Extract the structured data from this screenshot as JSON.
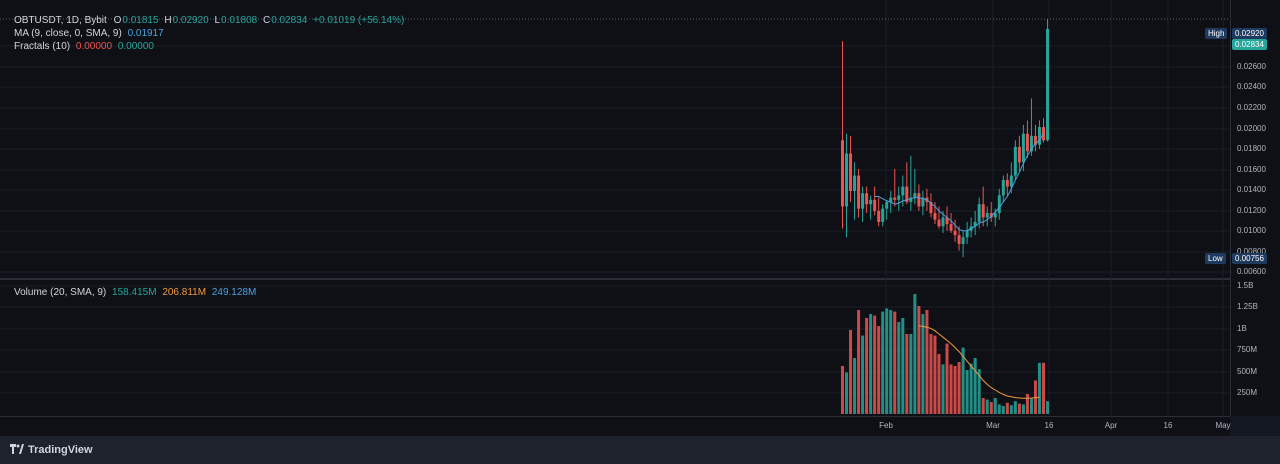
{
  "legend": {
    "symbol": "OBTUSDT, 1D, Bybit",
    "open_label": "O",
    "open": "0.01815",
    "high_label": "H",
    "high": "0.02920",
    "low_label": "L",
    "low": "0.01808",
    "close_label": "C",
    "close": "0.02834",
    "change": "+0.01019 (+56.14%)",
    "ma_label": "MA (9, close, 0, SMA, 9)",
    "ma_value": "0.01917",
    "fractals_label": "Fractals (10)",
    "fractal_up": "0.00000",
    "fractal_down": "0.00000",
    "volume_label": "Volume (20, SMA, 9)",
    "vol_value": "158.415M",
    "vol_sma20": "206.811M",
    "vol_sma9": "249.128M"
  },
  "price_axis": [
    "0.02800",
    "0.02600",
    "0.02400",
    "0.02200",
    "0.02000",
    "0.01800",
    "0.01600",
    "0.01400",
    "0.01200",
    "0.01000",
    "0.00800",
    "0.00600"
  ],
  "volume_axis": [
    "1.5B",
    "1.25B",
    "1B",
    "750M",
    "500M",
    "250M"
  ],
  "time_axis": [
    "Feb",
    "Mar",
    "16",
    "Apr",
    "16",
    "May"
  ],
  "markers": {
    "high_tag": "High",
    "high_value": "0.02920",
    "last_value": "0.02834",
    "low_tag": "Low",
    "low_value": "0.00756"
  },
  "brand": "TradingView",
  "colors": {
    "up": "#26a69a",
    "down": "#ef5350",
    "ma": "#4aa3df",
    "vol_sma20": "#f29a3d",
    "vol_sma9": "#4aa3df"
  },
  "chart_data": {
    "type": "candlestick",
    "price_range": [
      0.0058,
      0.0302
    ],
    "volume_range": [
      0,
      1600000000
    ],
    "candles": [
      {
        "o": 0.0182,
        "h": 0.0272,
        "l": 0.0102,
        "c": 0.0122,
        "v": 600000000
      },
      {
        "o": 0.0122,
        "h": 0.0188,
        "l": 0.0094,
        "c": 0.017,
        "v": 520000000
      },
      {
        "o": 0.017,
        "h": 0.0186,
        "l": 0.0126,
        "c": 0.0136,
        "v": 1050000000
      },
      {
        "o": 0.0136,
        "h": 0.0162,
        "l": 0.011,
        "c": 0.015,
        "v": 700000000
      },
      {
        "o": 0.015,
        "h": 0.0156,
        "l": 0.0112,
        "c": 0.012,
        "v": 1300000000
      },
      {
        "o": 0.012,
        "h": 0.014,
        "l": 0.0108,
        "c": 0.0134,
        "v": 980000000
      },
      {
        "o": 0.0134,
        "h": 0.014,
        "l": 0.0116,
        "c": 0.0124,
        "v": 1200000000
      },
      {
        "o": 0.0124,
        "h": 0.0132,
        "l": 0.011,
        "c": 0.0128,
        "v": 1250000000
      },
      {
        "o": 0.0128,
        "h": 0.014,
        "l": 0.0114,
        "c": 0.0118,
        "v": 1230000000
      },
      {
        "o": 0.0118,
        "h": 0.013,
        "l": 0.0104,
        "c": 0.0108,
        "v": 1100000000
      },
      {
        "o": 0.0108,
        "h": 0.0124,
        "l": 0.0104,
        "c": 0.012,
        "v": 1280000000
      },
      {
        "o": 0.012,
        "h": 0.0128,
        "l": 0.011,
        "c": 0.0126,
        "v": 1320000000
      },
      {
        "o": 0.0126,
        "h": 0.0136,
        "l": 0.0116,
        "c": 0.013,
        "v": 1300000000
      },
      {
        "o": 0.013,
        "h": 0.0156,
        "l": 0.0122,
        "c": 0.0128,
        "v": 1280000000
      },
      {
        "o": 0.0128,
        "h": 0.014,
        "l": 0.0118,
        "c": 0.0132,
        "v": 1150000000
      },
      {
        "o": 0.0132,
        "h": 0.015,
        "l": 0.0122,
        "c": 0.014,
        "v": 1200000000
      },
      {
        "o": 0.014,
        "h": 0.0162,
        "l": 0.0124,
        "c": 0.0126,
        "v": 1000000000
      },
      {
        "o": 0.0126,
        "h": 0.0168,
        "l": 0.0118,
        "c": 0.013,
        "v": 1000000000
      },
      {
        "o": 0.013,
        "h": 0.0156,
        "l": 0.0124,
        "c": 0.0134,
        "v": 1500000000
      },
      {
        "o": 0.0134,
        "h": 0.0142,
        "l": 0.0118,
        "c": 0.0122,
        "v": 1350000000
      },
      {
        "o": 0.0122,
        "h": 0.0136,
        "l": 0.0114,
        "c": 0.013,
        "v": 1250000000
      },
      {
        "o": 0.013,
        "h": 0.0138,
        "l": 0.0118,
        "c": 0.0126,
        "v": 1300000000
      },
      {
        "o": 0.0126,
        "h": 0.0134,
        "l": 0.0112,
        "c": 0.0116,
        "v": 1000000000
      },
      {
        "o": 0.0116,
        "h": 0.0126,
        "l": 0.0106,
        "c": 0.011,
        "v": 980000000
      },
      {
        "o": 0.011,
        "h": 0.0122,
        "l": 0.0102,
        "c": 0.0104,
        "v": 750000000
      },
      {
        "o": 0.0104,
        "h": 0.0118,
        "l": 0.0098,
        "c": 0.0112,
        "v": 620000000
      },
      {
        "o": 0.0112,
        "h": 0.0122,
        "l": 0.01,
        "c": 0.0106,
        "v": 880000000
      },
      {
        "o": 0.0106,
        "h": 0.0116,
        "l": 0.0098,
        "c": 0.01,
        "v": 620000000
      },
      {
        "o": 0.01,
        "h": 0.011,
        "l": 0.009,
        "c": 0.0096,
        "v": 600000000
      },
      {
        "o": 0.0096,
        "h": 0.0104,
        "l": 0.0082,
        "c": 0.0088,
        "v": 650000000
      },
      {
        "o": 0.0088,
        "h": 0.01,
        "l": 0.0076,
        "c": 0.0094,
        "v": 830000000
      },
      {
        "o": 0.0094,
        "h": 0.0108,
        "l": 0.0088,
        "c": 0.01,
        "v": 550000000
      },
      {
        "o": 0.01,
        "h": 0.0112,
        "l": 0.0094,
        "c": 0.0104,
        "v": 630000000
      },
      {
        "o": 0.0104,
        "h": 0.0118,
        "l": 0.0096,
        "c": 0.0108,
        "v": 700000000
      },
      {
        "o": 0.0108,
        "h": 0.013,
        "l": 0.0102,
        "c": 0.0124,
        "v": 560000000
      },
      {
        "o": 0.0124,
        "h": 0.014,
        "l": 0.0104,
        "c": 0.0112,
        "v": 200000000
      },
      {
        "o": 0.0112,
        "h": 0.0122,
        "l": 0.0104,
        "c": 0.0116,
        "v": 180000000
      },
      {
        "o": 0.0116,
        "h": 0.0126,
        "l": 0.0108,
        "c": 0.0112,
        "v": 150000000
      },
      {
        "o": 0.0112,
        "h": 0.012,
        "l": 0.0104,
        "c": 0.0116,
        "v": 200000000
      },
      {
        "o": 0.0116,
        "h": 0.0138,
        "l": 0.011,
        "c": 0.0132,
        "v": 120000000
      },
      {
        "o": 0.0132,
        "h": 0.015,
        "l": 0.0126,
        "c": 0.0146,
        "v": 100000000
      },
      {
        "o": 0.0146,
        "h": 0.0152,
        "l": 0.0132,
        "c": 0.014,
        "v": 140000000
      },
      {
        "o": 0.014,
        "h": 0.0162,
        "l": 0.0134,
        "c": 0.015,
        "v": 110000000
      },
      {
        "o": 0.015,
        "h": 0.0182,
        "l": 0.0146,
        "c": 0.0176,
        "v": 160000000
      },
      {
        "o": 0.0176,
        "h": 0.0186,
        "l": 0.0154,
        "c": 0.0162,
        "v": 130000000
      },
      {
        "o": 0.0162,
        "h": 0.0196,
        "l": 0.0154,
        "c": 0.0188,
        "v": 120000000
      },
      {
        "o": 0.0188,
        "h": 0.02,
        "l": 0.0166,
        "c": 0.0172,
        "v": 250000000
      },
      {
        "o": 0.0172,
        "h": 0.022,
        "l": 0.0168,
        "c": 0.0186,
        "v": 200000000
      },
      {
        "o": 0.0186,
        "h": 0.0196,
        "l": 0.0172,
        "c": 0.0178,
        "v": 420000000
      },
      {
        "o": 0.0178,
        "h": 0.02,
        "l": 0.0174,
        "c": 0.0194,
        "v": 640000000
      },
      {
        "o": 0.0194,
        "h": 0.0202,
        "l": 0.018,
        "c": 0.0182,
        "v": 640000000
      },
      {
        "o": 0.0182,
        "h": 0.0292,
        "l": 0.0181,
        "c": 0.0283,
        "v": 160000000
      }
    ],
    "ma": [
      null,
      null,
      null,
      null,
      null,
      null,
      null,
      null,
      0.0131,
      0.0131,
      0.0129,
      0.0127,
      0.0126,
      0.0124,
      0.0125,
      0.0127,
      0.0128,
      0.0129,
      0.013,
      0.013,
      0.0129,
      0.0128,
      0.0125,
      0.0122,
      0.0118,
      0.0115,
      0.0112,
      0.0109,
      0.0105,
      0.0101,
      0.01,
      0.01,
      0.0102,
      0.0104,
      0.0107,
      0.0108,
      0.011,
      0.0113,
      0.0117,
      0.0121,
      0.0126,
      0.0131,
      0.0138,
      0.0146,
      0.0153,
      0.0161,
      0.0168,
      0.0174,
      0.0179,
      0.0182,
      0.0188
    ],
    "vol_sma20": [
      null,
      null,
      null,
      null,
      null,
      null,
      null,
      null,
      null,
      null,
      null,
      null,
      null,
      null,
      null,
      null,
      null,
      null,
      null,
      1100000000,
      1095000000,
      1085000000,
      1070000000,
      1040000000,
      1000000000,
      960000000,
      920000000,
      880000000,
      830000000,
      780000000,
      720000000,
      660000000,
      600000000,
      540000000,
      480000000,
      420000000,
      370000000,
      330000000,
      300000000,
      270000000,
      245000000,
      225000000,
      215000000,
      205000000,
      200000000,
      198000000,
      198000000,
      200000000,
      205000000,
      207000000
    ],
    "vol_sma9": [
      null,
      null,
      null,
      null,
      null,
      null,
      null,
      null,
      null,
      null,
      null,
      null,
      null,
      null,
      null,
      null,
      null,
      null,
      null,
      null,
      null,
      null,
      null,
      null,
      null,
      null,
      null,
      null,
      null,
      null,
      null,
      null,
      null,
      null,
      null,
      null,
      null,
      null,
      null,
      null,
      null,
      null,
      null,
      null,
      null,
      null,
      null,
      null,
      null,
      null,
      null
    ]
  }
}
